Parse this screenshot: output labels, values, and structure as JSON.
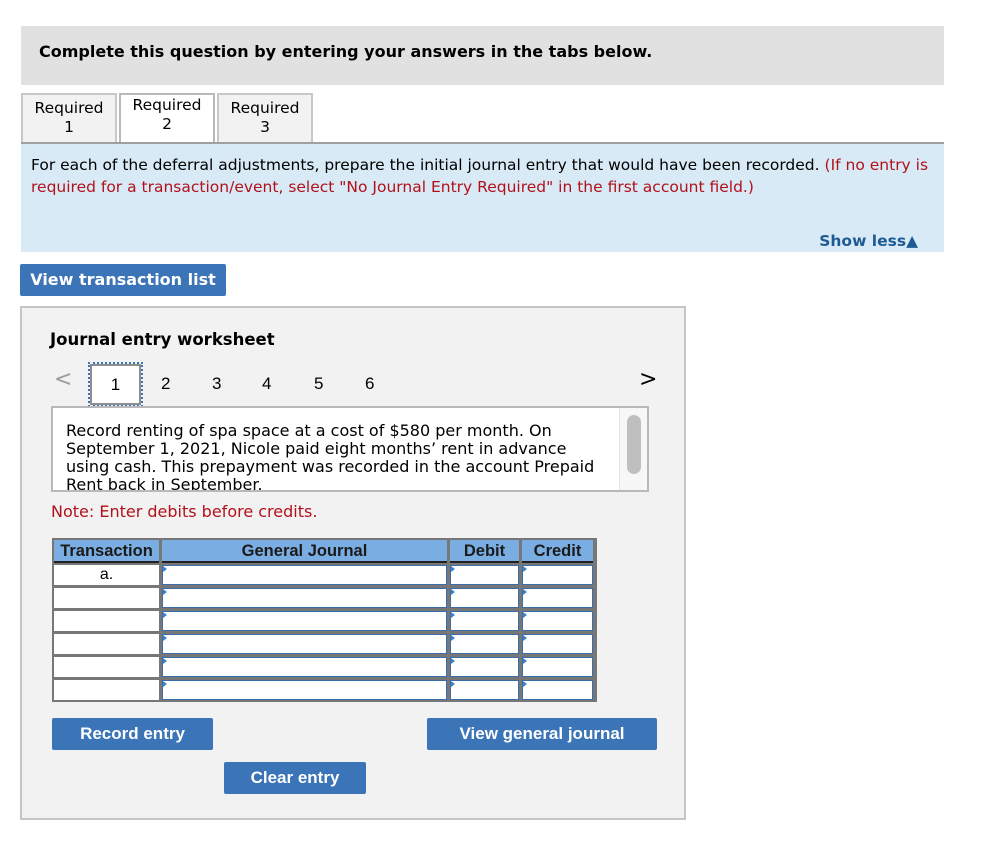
{
  "header": {
    "instruction": "Complete this question by entering your answers in the tabs below."
  },
  "tabs": [
    {
      "line1": "Required",
      "line2": "1",
      "active": false
    },
    {
      "line1": "Required",
      "line2": "2",
      "active": true
    },
    {
      "line1": "Required",
      "line2": "3",
      "active": false
    }
  ],
  "info": {
    "text": "For each of the deferral adjustments, prepare the initial journal entry that would have been recorded.",
    "red_text": "(If no entry is required for a transaction/event, select \"No Journal Entry Required\" in the first account field.)",
    "show_less_label": "Show less",
    "show_less_icon": "▲"
  },
  "buttons": {
    "view_transaction_list": "View transaction list",
    "record_entry": "Record entry",
    "clear_entry": "Clear entry",
    "view_general_journal": "View general journal"
  },
  "worksheet": {
    "title": "Journal entry worksheet",
    "prev_icon": "<",
    "next_icon": ">",
    "pages": [
      "1",
      "2",
      "3",
      "4",
      "5",
      "6"
    ],
    "active_page": "1",
    "description": "Record renting of spa space at a cost of $580 per month. On September 1, 2021, Nicole paid eight months’ rent in advance using cash. This prepayment was recorded in the account Prepaid Rent back in September.",
    "note": "Note: Enter debits before credits.",
    "table": {
      "headers": [
        "Transaction",
        "General Journal",
        "Debit",
        "Credit"
      ],
      "rows": [
        {
          "transaction": "a.",
          "account": "",
          "debit": "",
          "credit": ""
        },
        {
          "transaction": "",
          "account": "",
          "debit": "",
          "credit": ""
        },
        {
          "transaction": "",
          "account": "",
          "debit": "",
          "credit": ""
        },
        {
          "transaction": "",
          "account": "",
          "debit": "",
          "credit": ""
        },
        {
          "transaction": "",
          "account": "",
          "debit": "",
          "credit": ""
        },
        {
          "transaction": "",
          "account": "",
          "debit": "",
          "credit": ""
        }
      ]
    }
  },
  "colors": {
    "accent_button": "#3b74b7",
    "info_background": "#d9eaf7",
    "instruction_red": "#b1111a",
    "table_header": "#7aaee2",
    "link_blue": "#1e5b94"
  }
}
